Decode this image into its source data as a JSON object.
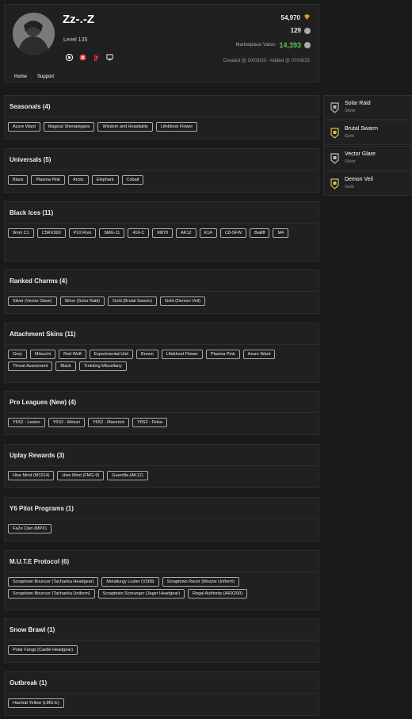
{
  "profile": {
    "username": "Zz-.-Z",
    "level": "Level 135",
    "credits": "54,970",
    "renown": "129",
    "marketplace_label": "Marketplace Value:",
    "marketplace_value": "14,393",
    "created": "Created @ 20/03/20 - Added @ 07/08/25",
    "platforms": [
      "ubisoft-icon",
      "xbox-icon",
      "playstation-icon",
      "pc-icon"
    ],
    "nav": [
      "Home",
      "Support"
    ]
  },
  "sections": [
    {
      "title": "Seasonals (4)",
      "tags": [
        "Azure Ward",
        "Magical Shenanigans",
        "Wisdom and Hospitality",
        "Lifeblood Flower"
      ]
    },
    {
      "title": "Universals (5)",
      "tags": [
        "Black",
        "Plasma Pink",
        "Arctic",
        "Elephant",
        "Cobalt"
      ]
    },
    {
      "title": "Black Ices (11)",
      "tags": [
        "9mm C1",
        "C5RX300",
        "P10 Roni",
        "SMG-11",
        "416-C",
        "M870",
        "AK12",
        "K1A",
        "C8-SFW",
        "Bailiff",
        "M4"
      ]
    },
    {
      "title": "Ranked Charms (4)",
      "tags": [
        "Silver (Vector Glare)",
        "Silver (Solar Raid)",
        "Gold (Brutal Swarm)",
        "Gold (Demon Veil)"
      ]
    },
    {
      "title": "Attachment Skins (11)",
      "tags": [
        "Grey",
        "Mitsuchi",
        "Red Wolf",
        "Experimental Unit",
        "Brown",
        "Lifeblood Flower",
        "Plasma Pink",
        "Azure Ward",
        "Threat Assesment",
        "Black",
        "Trekking Miscellany"
      ]
    },
    {
      "title": "Pro Leagues (New) (4)",
      "tags": [
        "Y6S2 - Lesion",
        "Y6S2 - Melusi",
        "Y6S2 - Maverick",
        "Y6S2 - Finka"
      ]
    },
    {
      "title": "Uplay Rewards (3)",
      "tags": [
        "Hive Mind (M1014)",
        "Hive Mind (FMG-9)",
        "Guerrilla (AK12)"
      ]
    },
    {
      "title": "Y6 Pilot Programs (1)",
      "tags": [
        "FaZe Clan (MPX)"
      ]
    },
    {
      "title": "M.U.T.E Protocol (6)",
      "tags": [
        "Scraptown Bouncer (Tachanka Headgear)",
        "Metallurgy Luster (V308)",
        "Scraptown Racer (Mozzie Uniform)",
        "Scraptown Bouncer (Tachanka Uniform)",
        "Scraptown Scrounger (Jager Headgear)",
        "Regal Authority (ARX200)"
      ]
    },
    {
      "title": "Snow Brawl (1)",
      "tags": [
        "Polar Fangs (Castle Headgear)"
      ]
    },
    {
      "title": "Outbreak (1)",
      "tags": [
        "Hazmat Yellow (LMG-E)"
      ]
    }
  ],
  "charms": [
    {
      "name": "Solar Raid",
      "tier": "Silver",
      "color": "#b8b8b8"
    },
    {
      "name": "Brutal Swarm",
      "tier": "Gold",
      "color": "#d8c050"
    },
    {
      "name": "Vector Glare",
      "tier": "Silver",
      "color": "#b8b8b8"
    },
    {
      "name": "Demon Veil",
      "tier": "Gold",
      "color": "#d8c050"
    }
  ]
}
